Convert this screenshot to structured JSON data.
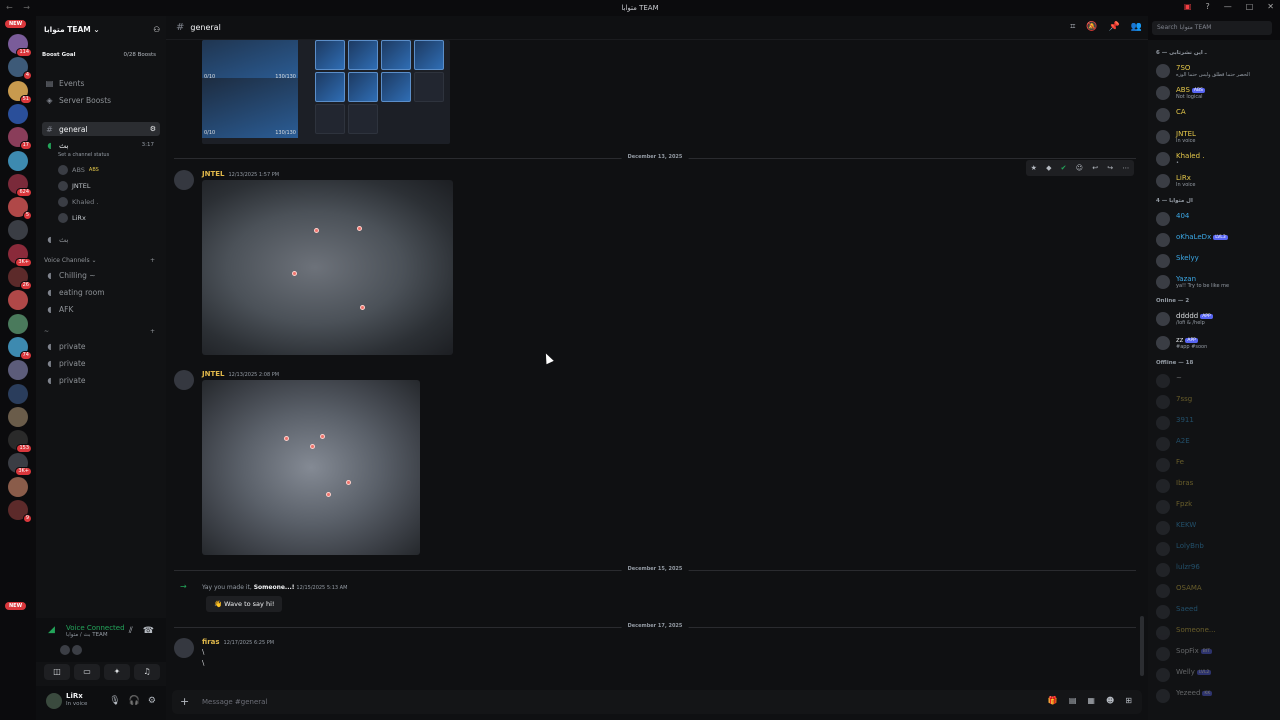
{
  "window": {
    "title": "متوابا TEAM"
  },
  "server": {
    "name": "متوابا TEAM",
    "boost_label": "Boost Goal",
    "boost_count": "0/28 Boosts"
  },
  "rail": {
    "new_top": "NEW",
    "new_bottom": "NEW",
    "badges": [
      "114",
      "4",
      "51",
      "",
      "17",
      "",
      "624",
      "5",
      "",
      "3K+",
      "26",
      "",
      "",
      "74",
      "",
      "",
      "",
      "153",
      "3K+",
      "",
      "9"
    ]
  },
  "sidebar": {
    "events": "Events",
    "server_boosts": "Server Boosts",
    "text_channels": [
      {
        "name": "general",
        "active": true
      }
    ],
    "voice_main": {
      "name": "بث",
      "time": "3:17",
      "status": "Set a channel status"
    },
    "voice_main_users": [
      {
        "name": "ABS",
        "tag": "ABS",
        "dim": true
      },
      {
        "name": "JNTEL",
        "dim": false
      },
      {
        "name": "Khaled .",
        "dim": true
      },
      {
        "name": "LiRx",
        "dim": false
      }
    ],
    "voice2": "بث",
    "voice_category": "Voice Channels",
    "voice_channels": [
      "Chilling ~",
      "eating room",
      "AFK"
    ],
    "private_category": "~",
    "private_channels": [
      "private",
      "private",
      "private"
    ]
  },
  "voice": {
    "connected": "Voice Connected",
    "channel": "بث / متوابا TEAM"
  },
  "user": {
    "name": "LiRx",
    "status": "In voice"
  },
  "channel": {
    "name": "general",
    "placeholder": "Message #general"
  },
  "search": {
    "placeholder": "Search متوابا TEAM"
  },
  "chat": {
    "top_image": {
      "left_count_1": "0/10",
      "right_count_1": "130/130",
      "left_count_2": "0/10",
      "right_count_2": "130/130"
    },
    "divider1": "December 13, 2025",
    "messages": [
      {
        "author": "JNTEL",
        "time": "12/13/2025 1:57 PM"
      },
      {
        "author": "JNTEL",
        "time": "12/13/2025 2:08 PM"
      }
    ],
    "divider2": "December 15, 2025",
    "join": {
      "prefix": "Yay you made it,",
      "user": "Someone...!",
      "time": "12/15/2025 5:13 AM",
      "button": "Wave to say hi!"
    },
    "divider3": "December 17, 2025",
    "last": {
      "author": "firas",
      "time": "12/17/2025 6:25 PM",
      "line1": "\\",
      "line2": "\\"
    }
  },
  "members": {
    "group1": "ـ اين نشرتابى — 6",
    "group1_members": [
      {
        "name": "7SO",
        "status": "الحصر حتما قطلق وليس حتما الوزه",
        "color": "#e5c84a"
      },
      {
        "name": "ABS",
        "tag": "ABS",
        "status": "Not logical",
        "color": "#e5c84a"
      },
      {
        "name": "CA",
        "status": "",
        "color": "#e5c84a"
      },
      {
        "name": "JNTEL",
        "status": "In voice",
        "color": "#e5c84a"
      },
      {
        "name": "Khaled .",
        "status": "•",
        "color": "#e5c84a"
      },
      {
        "name": "LiRx",
        "status": "In voice",
        "color": "#e5c84a"
      }
    ],
    "group2": "ال متوابا — 4",
    "group2_members": [
      {
        "name": "404",
        "status": "",
        "color": "#3ba7e5"
      },
      {
        "name": "oKhaLeDx",
        "tag": "LVL3",
        "status": "",
        "color": "#3ba7e5"
      },
      {
        "name": "Skelyy",
        "status": "",
        "color": "#3ba7e5"
      },
      {
        "name": "Yazan",
        "status": "ya!! Try to be like me",
        "color": "#3ba7e5"
      }
    ],
    "online": "Online — 2",
    "online_members": [
      {
        "name": "ddddd",
        "tag": "APP",
        "status": "/lofi & /help",
        "color": "#dbdee1"
      },
      {
        "name": "zz",
        "tag": "APP",
        "status": "#app #soon",
        "color": "#dbdee1"
      }
    ],
    "offline": "Offline — 18",
    "offline_members": [
      {
        "name": "~",
        "color": "#dbdee1"
      },
      {
        "name": "7ssg",
        "color": "#e5c84a"
      },
      {
        "name": "3911",
        "color": "#3ba7e5"
      },
      {
        "name": "A2E",
        "color": "#3ba7e5"
      },
      {
        "name": "Fe",
        "color": "#e5c84a"
      },
      {
        "name": "Ibras",
        "color": "#e5c84a"
      },
      {
        "name": "Fpzk",
        "color": "#e5c84a"
      },
      {
        "name": "KEKW",
        "color": "#3ba7e5"
      },
      {
        "name": "LolyBnb",
        "color": "#3ba7e5"
      },
      {
        "name": "lulzr96",
        "color": "#3ba7e5"
      },
      {
        "name": "OSAMA",
        "color": "#e5c84a"
      },
      {
        "name": "Saeed",
        "color": "#3ba7e5"
      },
      {
        "name": "Someone...",
        "color": "#e5c84a"
      },
      {
        "name": "SopFix",
        "tag": "BIT",
        "color": "#dbdee1"
      },
      {
        "name": "Welly",
        "tag": "LVL2",
        "color": "#dbdee1"
      },
      {
        "name": "Yezeed",
        "tag": "KK",
        "color": "#dbdee1"
      }
    ]
  }
}
